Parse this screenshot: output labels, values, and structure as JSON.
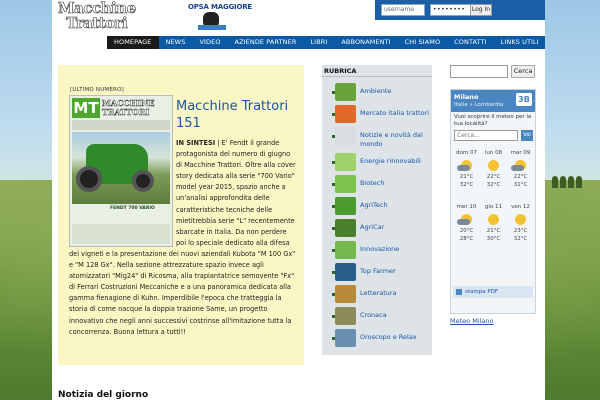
{
  "header": {
    "logo_text_line1": "Macchine",
    "logo_text_line2": "Trattori",
    "partner_logo_text": "OPSA MAGGIORE"
  },
  "login": {
    "username_placeholder": "username",
    "password_value": "••••••••",
    "button_label": "Log In"
  },
  "nav": {
    "items": [
      "HOMEPAGE",
      "NEWS",
      "VIDEO",
      "AZIENDE PARTNER",
      "LIBRI",
      "ABBONAMENTI",
      "CHI SIAMO",
      "CONTATTI",
      "LINKS UTILI"
    ]
  },
  "feature": {
    "tag": "[ULTIMO NUMERO]",
    "cover_title_line1": "MACCHINE",
    "cover_title_line2": "TRATTORI",
    "cover_logo": "MT",
    "cover_caption": "FENDT 700 VARIO",
    "title": "Macchine Trattori 151",
    "lead": "IN SINTESI",
    "body_top": " | E' Fendt il grande protagonista del numero di giugno di Macchine Trattori. Oltre alla cover story dedicata alla serie \"700 Vario\" model year 2015, spazio anche a un'analisi approfondita delle caratteristiche tecniche delle mietitrebbia serie \"L\" recentemente sbarcate in Italia. Da non perdere poi lo speciale dedicato alla difesa",
    "body_bottom": "dei vigneti e la presentazione dei nuovi aziendali Kubota \"M 100 Gx\" e \"M 128 Gx\". Nella sezione attrezzature spazio invece agli atomizzatori \"Mig24\" di Ricosma, alla trapiantatrice semovente \"Fx\" di Ferrari Costruzioni Meccaniche e a una panoramica dedicata alla gamma fienagione di Kuhn. Imperdibile l'epoca che tratteggia la storia di come nacque la doppia trazione Same, un progetto innovativo che negli anni successivi costrinse all'imitazione tutta la concorrenza. Buona lettura a tutti!!"
  },
  "notizia_title": "Notizia del giorno",
  "rubrica": {
    "title": "RUBRICA",
    "items": [
      {
        "label": "Ambiente",
        "icon": "landscape-icon",
        "color": "#6aa23a"
      },
      {
        "label": "Mercato italia trattori",
        "icon": "mt-logo-icon",
        "color": "#e0692a"
      },
      {
        "label": "Notizie e novità dal mondo",
        "icon": "keyboard-icon",
        "color": "#d9dde0"
      },
      {
        "label": "Energie rinnovabili",
        "icon": "bulb-icon",
        "color": "#9fd26a"
      },
      {
        "label": "Biotech",
        "icon": "molecule-icon",
        "color": "#7dc24b"
      },
      {
        "label": "AgriTech",
        "icon": "leaf-icon",
        "color": "#4c9b2e"
      },
      {
        "label": "AgriCar",
        "icon": "car-icon",
        "color": "#4a7f2c"
      },
      {
        "label": "Innovazione",
        "icon": "bulb-green-icon",
        "color": "#72b84a"
      },
      {
        "label": "Top Farmer",
        "icon": "person-icon",
        "color": "#2a5f8c"
      },
      {
        "label": "Letteratura",
        "icon": "book-icon",
        "color": "#b78a3a"
      },
      {
        "label": "Cronaca",
        "icon": "news-icon",
        "color": "#8a8a5a"
      },
      {
        "label": "Oroscopo e Relax",
        "icon": "scale-icon",
        "color": "#6a8fb0"
      }
    ]
  },
  "search": {
    "placeholder": "",
    "button_label": "Cerca"
  },
  "meteo": {
    "city": "Milano",
    "crumbs": "Italia  »  Lombardia",
    "badge": "3B",
    "question": "Vuoi scoprire il meteo per la tua località?",
    "search_placeholder": "Cerca...",
    "go_label": "Vai",
    "days": [
      {
        "day": "dom 07",
        "t_max": "21°C",
        "t_min": "32°C",
        "icon": "cloud-sun-icon"
      },
      {
        "day": "lun 08",
        "t_max": "22°C",
        "t_min": "32°C",
        "icon": "sun-icon"
      },
      {
        "day": "mar 09",
        "t_max": "22°C",
        "t_min": "31°C",
        "icon": "cloud-sun-icon"
      },
      {
        "day": "mer 10",
        "t_max": "20°C",
        "t_min": "28°C",
        "icon": "cloud-sun-icon"
      },
      {
        "day": "gio 11",
        "t_max": "21°C",
        "t_min": "30°C",
        "icon": "sun-icon"
      },
      {
        "day": "ven 12",
        "t_max": "23°C",
        "t_min": "32°C",
        "icon": "sun-icon"
      }
    ],
    "pdf_label": "stampa PDF",
    "link_label": "Meteo Milano"
  }
}
